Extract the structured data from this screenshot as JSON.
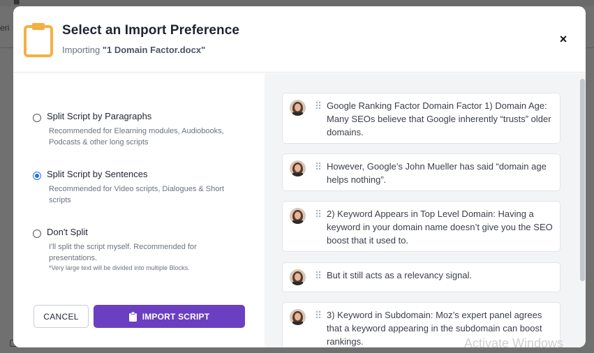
{
  "background": {
    "left_text": "eri"
  },
  "modal": {
    "title": "Select an Import Preference",
    "subtitle_prefix": "Importing ",
    "filename": "\"1 Domain Factor.docx\"",
    "close_label": "×"
  },
  "options": [
    {
      "label": "Split Script by Paragraphs",
      "description": "Recommended for Elearning modules, Audiobooks, Podcasts & other long scripts",
      "selected": false
    },
    {
      "label": "Split Script by Sentences",
      "description": "Recommended for Video scripts, Dialogues & Short scripts",
      "selected": true
    },
    {
      "label": "Don't Split",
      "description": "I'll split the script myself. Recommended for presentations.",
      "note": "*Very large text will be divided into multiple Blocks.",
      "selected": false
    }
  ],
  "buttons": {
    "cancel": "CANCEL",
    "import": "IMPORT SCRIPT"
  },
  "blocks": [
    {
      "text": "Google Ranking Factor Domain Factor 1) Domain Age: Many SEOs believe that Google inherently “trusts” older domains."
    },
    {
      "text": "However, Google’s John Mueller has said “domain age helps nothing”."
    },
    {
      "text": "2) Keyword Appears in Top Level Domain: Having a keyword in your domain name doesn’t give you the SEO boost that it used to."
    },
    {
      "text": "But it still acts as a relevancy signal."
    },
    {
      "text": "3) Keyword in Subdomain: Moz’s expert panel agrees that a keyword appearing in the subdomain can boost rankings."
    }
  ],
  "watermark": "Activate Windows",
  "colors": {
    "accent": "#6a3fc2",
    "radio_selected": "#1a73e8",
    "clipboard": "#f5b042"
  },
  "icons": {
    "clipboard": "clipboard-icon",
    "close": "close-icon",
    "drag": "drag-handle-icon",
    "avatar": "avatar"
  }
}
